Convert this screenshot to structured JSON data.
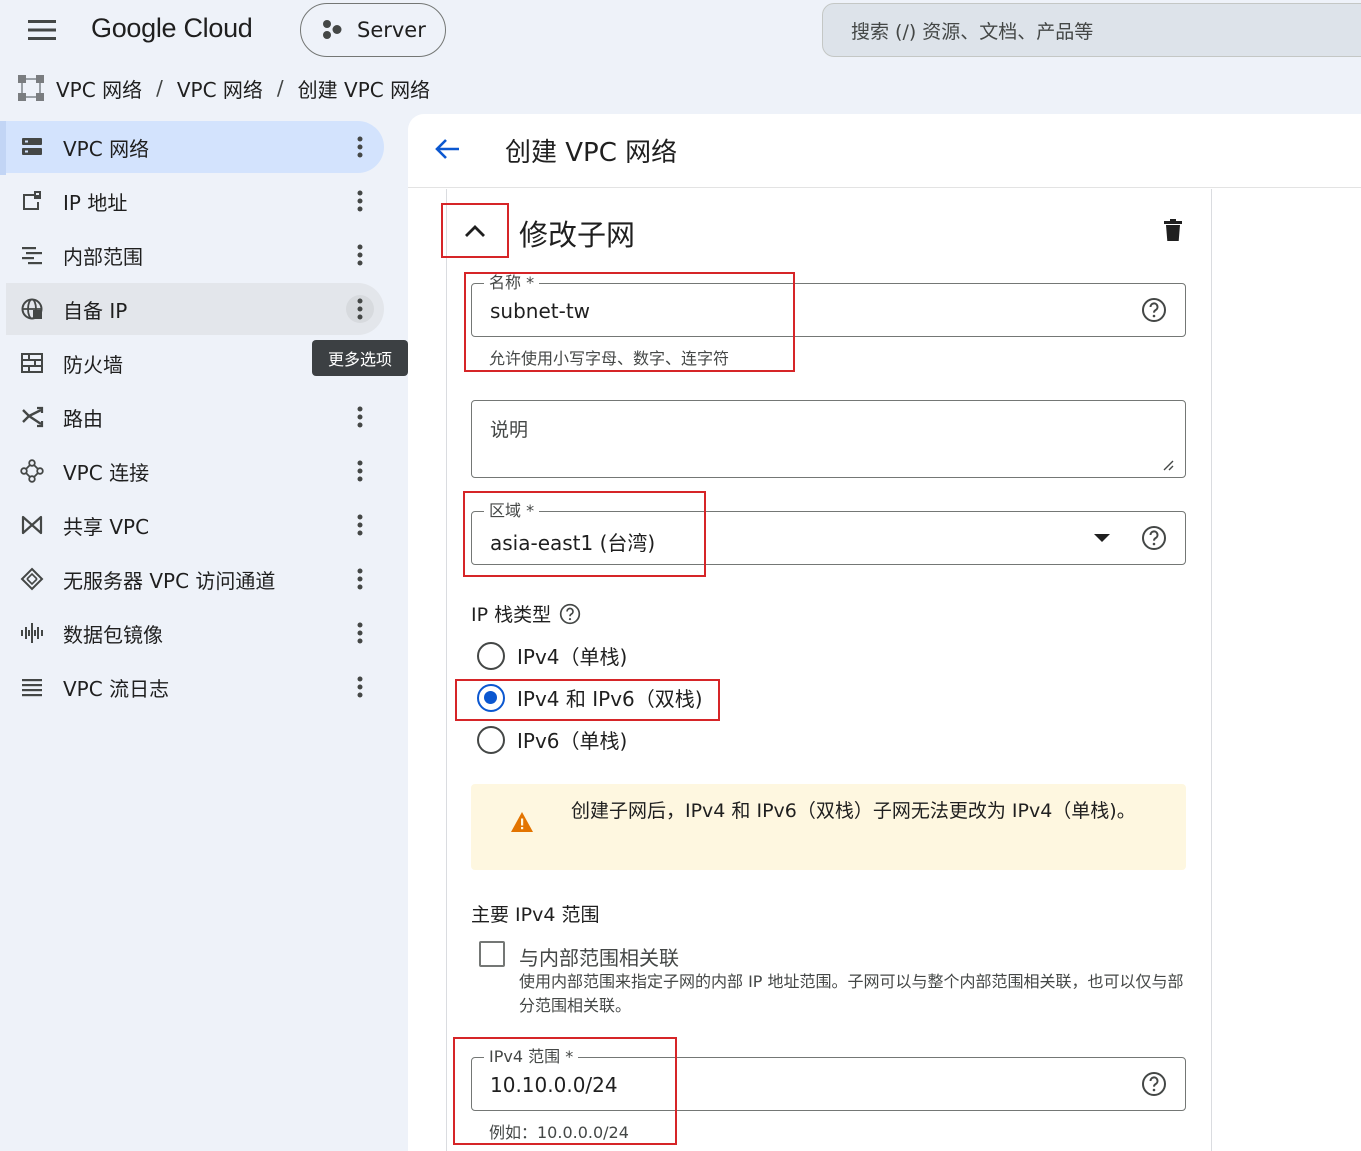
{
  "topbar": {
    "logo": "Google Cloud",
    "project": "Server",
    "search_placeholder": "搜索 (/) 资源、文档、产品等"
  },
  "breadcrumb": [
    "VPC 网络",
    "VPC 网络",
    "创建 VPC 网络"
  ],
  "breadcrumb_sep": "/",
  "sidebar": {
    "items": [
      {
        "label": "VPC 网络",
        "icon": "vpc-network-icon",
        "active": true
      },
      {
        "label": "IP 地址",
        "icon": "ip-address-icon"
      },
      {
        "label": "内部范围",
        "icon": "internal-ranges-icon"
      },
      {
        "label": "自备 IP",
        "icon": "globe-icon",
        "hover": true
      },
      {
        "label": "防火墙",
        "icon": "firewall-icon"
      },
      {
        "label": "路由",
        "icon": "routes-icon"
      },
      {
        "label": "VPC 连接",
        "icon": "vpc-connection-icon"
      },
      {
        "label": "共享 VPC",
        "icon": "shared-vpc-icon"
      },
      {
        "label": "无服务器 VPC 访问通道",
        "icon": "serverless-icon"
      },
      {
        "label": "数据包镜像",
        "icon": "packet-mirror-icon"
      },
      {
        "label": "VPC 流日志",
        "icon": "flow-logs-icon"
      }
    ],
    "tooltip": "更多选项"
  },
  "main": {
    "page_title": "创建 VPC 网络",
    "section_title": "修改子网",
    "name_field": {
      "label": "名称 *",
      "value": "subnet-tw",
      "hint": "允许使用小写字母、数字、连字符"
    },
    "description_field": {
      "placeholder": "说明"
    },
    "region_field": {
      "label": "区域 *",
      "value": "asia-east1 (台湾)"
    },
    "ip_stack": {
      "label": "IP 栈类型",
      "options": [
        "IPv4（单栈)",
        "IPv4 和 IPv6（双栈)",
        "IPv6（单栈)"
      ],
      "selected_index": 1
    },
    "warning": "创建子网后，IPv4 和 IPv6（双栈）子网无法更改为 IPv4（单栈)。",
    "primary_range": {
      "label": "主要 IPv4 范围",
      "checkbox_label": "与内部范围相关联",
      "checkbox_checked": false,
      "checkbox_desc": "使用内部范围来指定子网的内部 IP 地址范围。子网可以与整个内部范围相关联，也可以仅与部分范围相关联。"
    },
    "ipv4_field": {
      "label": "IPv4 范围 *",
      "value": "10.10.0.0/24",
      "hint": "例如：10.0.0.0/24"
    }
  },
  "colors": {
    "accent": "#0b57d0",
    "annotation": "#d62528",
    "warning": "#e37400"
  }
}
